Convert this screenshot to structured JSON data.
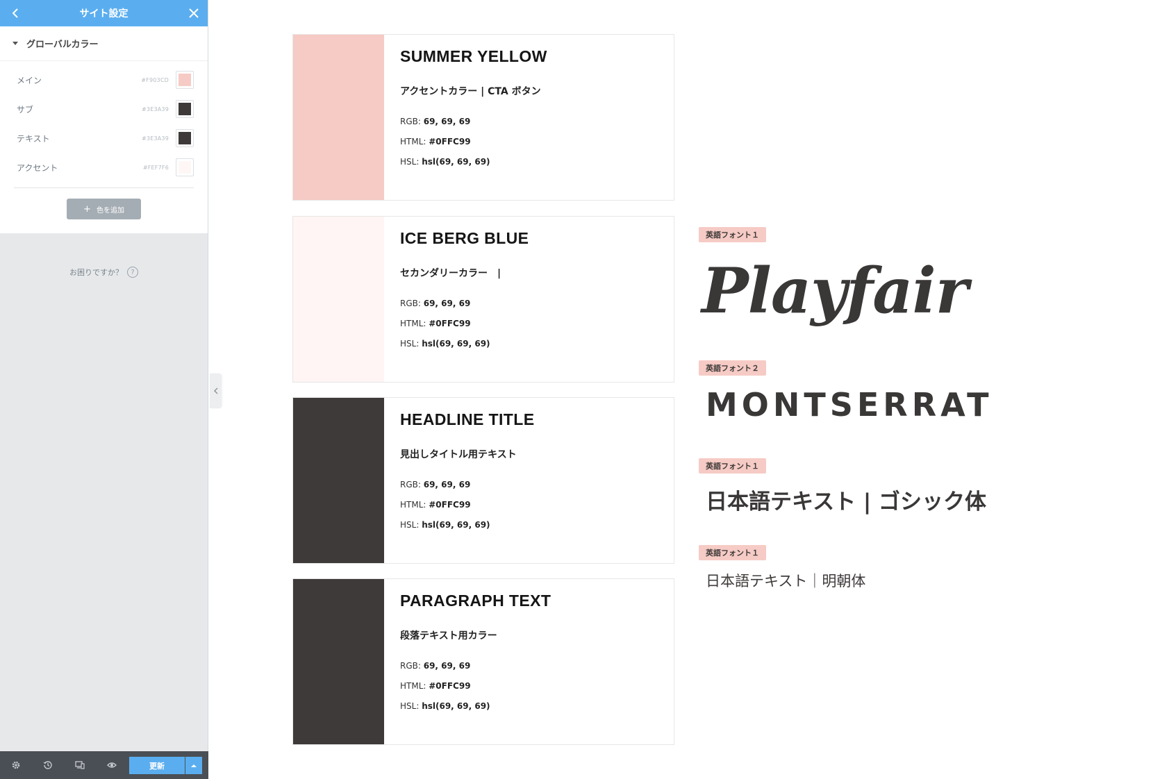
{
  "sidebar": {
    "title": "サイト設定",
    "section_title": "グローバルカラー",
    "colors": [
      {
        "name": "メイン",
        "hex": "#F903CD",
        "swatch": "#f6cbc5"
      },
      {
        "name": "サブ",
        "hex": "#3E3A39",
        "swatch": "#3e3a39"
      },
      {
        "name": "テキスト",
        "hex": "#3E3A39",
        "swatch": "#3e3a39"
      },
      {
        "name": "アクセント",
        "hex": "#FEF7F6",
        "swatch": "#fef7f6"
      }
    ],
    "add_color_label": "色を追加",
    "help_text": "お困りですか？",
    "footer": {
      "update_label": "更新"
    }
  },
  "cards": [
    {
      "title": "SUMMER YELLOW",
      "subtitle": "アクセントカラー | CTA ボタン",
      "swatch_color": "#f6cbc5",
      "rgb_label": "RGB: ",
      "rgb": "69, 69, 69",
      "html_label": "HTML: ",
      "html": "#0FFC99",
      "hsl_label": "HSL: ",
      "hsl": "hsl(69, 69, 69)"
    },
    {
      "title": "ICE BERG BLUE",
      "subtitle": "セカンダリーカラー　|",
      "swatch_color": "#fef5f4",
      "rgb_label": "RGB: ",
      "rgb": "69, 69, 69",
      "html_label": "HTML: ",
      "html": "#0FFC99",
      "hsl_label": "HSL: ",
      "hsl": "hsl(69, 69, 69)"
    },
    {
      "title": "HEADLINE TITLE",
      "subtitle": "見出しタイトル用テキスト",
      "swatch_color": "#3e3a39",
      "rgb_label": "RGB: ",
      "rgb": "69, 69, 69",
      "html_label": "HTML: ",
      "html": "#0FFC99",
      "hsl_label": "HSL: ",
      "hsl": "hsl(69, 69, 69)"
    },
    {
      "title": "PARAGRAPH TEXT",
      "subtitle": "段落テキスト用カラー",
      "swatch_color": "#3e3a39",
      "rgb_label": "RGB: ",
      "rgb": "69, 69, 69",
      "html_label": "HTML: ",
      "html": "#0FFC99",
      "hsl_label": "HSL: ",
      "hsl": "hsl(69, 69, 69)"
    }
  ],
  "fonts": [
    {
      "tag": "英語フォント１",
      "sample": "Playfair"
    },
    {
      "tag": "英語フォント２",
      "sample": "MONTSERRAT"
    },
    {
      "tag": "英語フォント１",
      "sample": "日本語テキスト | ゴシック体"
    },
    {
      "tag": "英語フォント１",
      "sample": "日本語テキスト｜明朝体"
    }
  ],
  "colors": {
    "accent_blue": "#5aaef0",
    "pink": "#f6cbc5",
    "dark": "#3e3a39"
  }
}
